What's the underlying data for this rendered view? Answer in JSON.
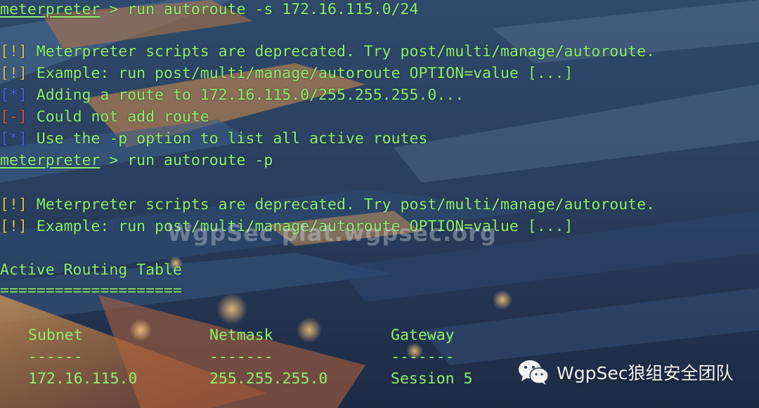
{
  "terminal": {
    "lines": [
      {
        "prompt": "meterpreter",
        "cmd": " > run autoroute -s 172.16.115.0/24"
      },
      {
        "tag": "[!]",
        "text": " Meterpreter scripts are deprecated. Try post/multi/manage/autoroute."
      },
      {
        "tag": "[!]",
        "text": " Example: run post/multi/manage/autoroute OPTION=value [...]"
      },
      {
        "tag": "[*]",
        "text": " Adding a route to 172.16.115.0/255.255.255.0..."
      },
      {
        "tag": "[-]",
        "text": " Could not add route"
      },
      {
        "tag": "[*]",
        "text": " Use the -p option to list all active routes"
      },
      {
        "prompt": "meterpreter",
        "cmd": " > run autoroute -p"
      },
      {
        "tag": "[!]",
        "text": " Meterpreter scripts are deprecated. Try post/multi/manage/autoroute."
      },
      {
        "tag": "[!]",
        "text": " Example: run post/multi/manage/autoroute OPTION=value [...]"
      },
      {
        "text": "Active Routing Table"
      },
      {
        "text": "===================="
      }
    ],
    "table": {
      "headers": [
        "Subnet",
        "Netmask",
        "Gateway"
      ],
      "separators": [
        "------",
        "-------",
        "-------"
      ],
      "rows": [
        [
          "172.16.115.0",
          "255.255.255.0",
          "Session 5"
        ]
      ]
    }
  },
  "overlay": {
    "watermark": "WgpSec plat.wgpsec.org",
    "brand": "WgpSec狼组安全团队",
    "brand_icon": "wechat-icon"
  },
  "colors": {
    "text": "#8ef06a",
    "warn_tag": "#d6c24a",
    "info_tag": "#4a5fd8",
    "error_tag": "#d8503a"
  }
}
